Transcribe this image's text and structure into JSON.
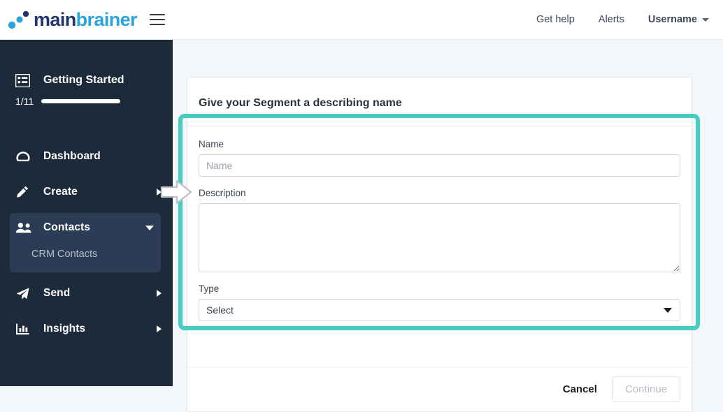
{
  "header": {
    "logo": {
      "part1": "main",
      "part2": "brainer",
      "dots_icon": "logo-dots-icon"
    },
    "menu_icon": "hamburger-menu-icon",
    "nav": [
      {
        "label": "Get help",
        "name": "get-help"
      },
      {
        "label": "Alerts",
        "name": "alerts"
      }
    ],
    "user": {
      "label": "Username",
      "caret_icon": "chevron-down-icon"
    }
  },
  "sidebar": {
    "getting_started": {
      "icon": "list-icon",
      "label": "Getting Started",
      "count": "1/11",
      "progress_percent": 9
    },
    "items": [
      {
        "label": "Dashboard",
        "icon": "dashboard-gauge-icon",
        "expandable": false,
        "active": false
      },
      {
        "label": "Create",
        "icon": "pencil-icon",
        "expandable": true,
        "active": false
      },
      {
        "label": "Contacts",
        "icon": "people-icon",
        "expandable": true,
        "active": true,
        "subitems": [
          {
            "label": "CRM Contacts"
          }
        ]
      },
      {
        "label": "Send",
        "icon": "paper-plane-icon",
        "expandable": true,
        "active": false
      },
      {
        "label": "Insights",
        "icon": "bar-chart-icon",
        "expandable": true,
        "active": false
      }
    ]
  },
  "card": {
    "title": "Give your Segment a describing name",
    "fields": {
      "name": {
        "label": "Name",
        "value": "",
        "placeholder": "Name"
      },
      "description": {
        "label": "Description",
        "value": "",
        "placeholder": ""
      },
      "type": {
        "label": "Type",
        "selected": "Select",
        "caret_icon": "triangle-down-icon"
      }
    },
    "footer": {
      "cancel_label": "Cancel",
      "continue_label": "Continue"
    }
  },
  "annotation": {
    "highlight_color": "#45cdc4",
    "arrow_icon": "right-arrow-pointer-icon"
  }
}
